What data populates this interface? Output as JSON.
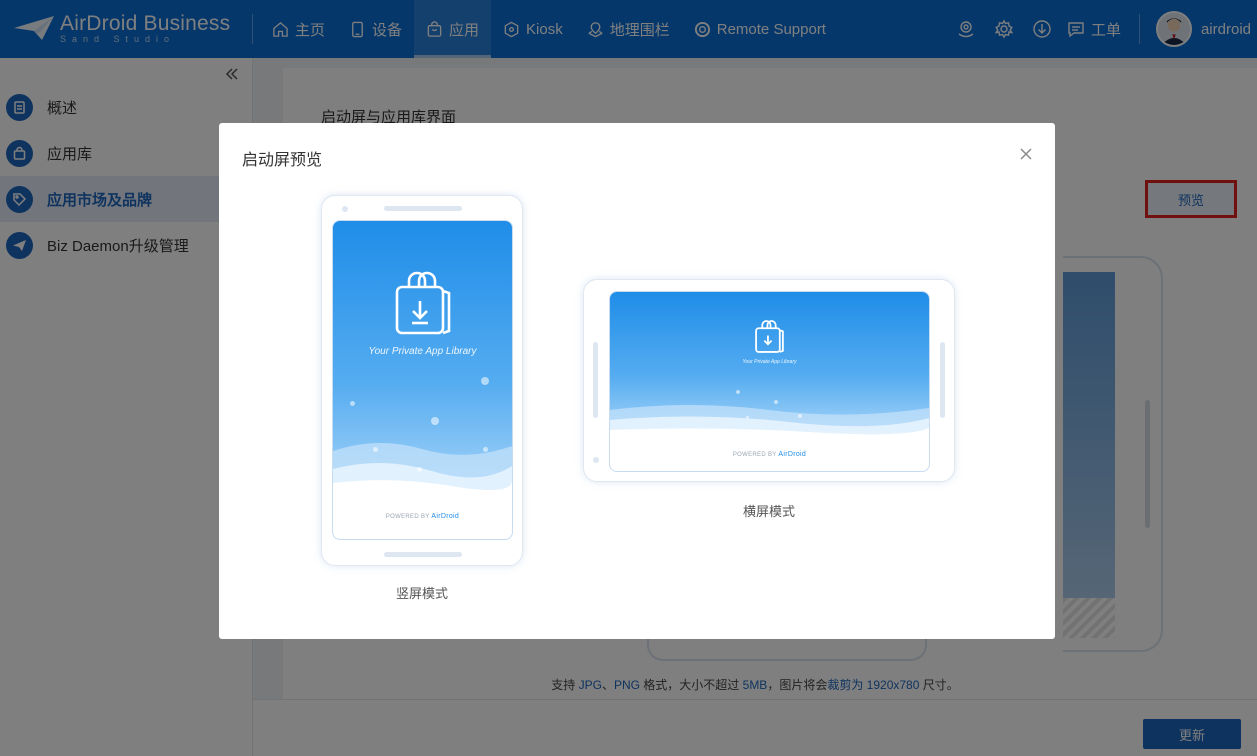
{
  "brand": {
    "name": "AirDroid Business",
    "sub": "Sand Studio"
  },
  "nav": [
    {
      "label": "主页",
      "icon": "home-icon"
    },
    {
      "label": "设备",
      "icon": "device-icon"
    },
    {
      "label": "应用",
      "icon": "bag-icon",
      "active": true
    },
    {
      "label": "Kiosk",
      "icon": "kiosk-icon"
    },
    {
      "label": "地理围栏",
      "icon": "geofence-icon"
    },
    {
      "label": "Remote Support",
      "icon": "lifebuoy-icon"
    }
  ],
  "tools": {
    "ticket_label": "工单",
    "username": "airdroid"
  },
  "sidebar": {
    "items": [
      {
        "label": "概述"
      },
      {
        "label": "应用库"
      },
      {
        "label": "应用市场及品牌",
        "active": true
      },
      {
        "label": "Biz Daemon升级管理"
      }
    ]
  },
  "main": {
    "section_title": "启动屏与应用库界面",
    "preview_link": "预览",
    "support": {
      "prefix": "支持 ",
      "jpg": "JPG",
      "sep": "、",
      "png": "PNG",
      "mid1": " 格式，大小不超过 ",
      "size": "5MB",
      "mid2": "，图片将会",
      "crop": "裁剪为 1920x780",
      "suffix": " 尺寸。"
    },
    "update_button": "更新"
  },
  "modal": {
    "title": "启动屏预览",
    "portrait_label": "竖屏模式",
    "landscape_label": "横屏模式",
    "screen_caption": "Your Private App Library",
    "powered_by": "POWERED BY",
    "powered_brand": "AirDroid"
  },
  "colors": {
    "primary": "#1f66bf",
    "topbar": "#0a6fd6",
    "highlight_border": "#e0221f"
  }
}
